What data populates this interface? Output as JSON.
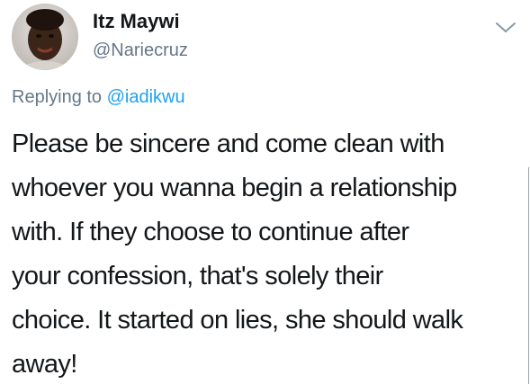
{
  "tweet": {
    "author": {
      "display_name": "Itz Maywi",
      "handle": "@Nariecruz",
      "avatar_icon": "profile-photo"
    },
    "menu_icon": "chevron-down-icon",
    "reply": {
      "prefix": "Replying to",
      "target": "@iadikwu"
    },
    "text_lines": [
      "Please be sincere and come clean with",
      "whoever you wanna begin a relationship",
      "with. If they choose to continue after",
      "your confession, that's solely their",
      "choice. It started on lies, she should walk",
      "away!"
    ]
  },
  "colors": {
    "name": "#14171a",
    "secondary": "#657786",
    "link": "#1da1f2"
  }
}
